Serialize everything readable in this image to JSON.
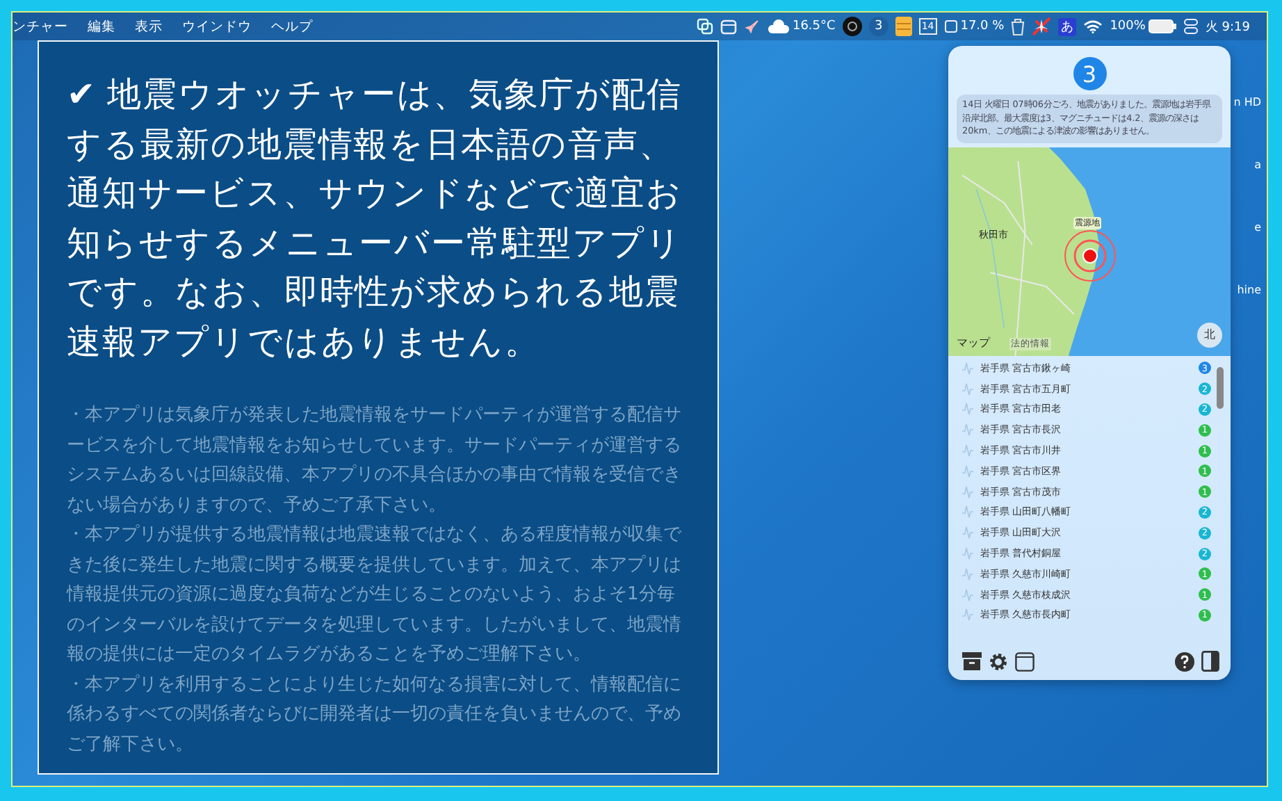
{
  "menu_bar": {
    "items": [
      "ンチャー",
      "編集",
      "表示",
      "ウインドウ",
      "ヘルプ"
    ],
    "status": {
      "temperature": "16.5°C",
      "badge": "3",
      "calendar_day": "14",
      "cpu": "17.0 %",
      "input_method": "あ",
      "battery": "100%",
      "clock": "火 9:19"
    }
  },
  "desktop_icons": [
    "n HD",
    "a",
    "e",
    "hine"
  ],
  "info_panel": {
    "headline": "✔ 地震ウオッチャーは、気象庁が配信する最新の地震情報を日本語の音声、通知サービス、サウンドなどで適宜お知らせするメニューバー常駐型アプリです。なお、即時性が求められる地震速報アプリではありません。",
    "notes": [
      "・本アプリは気象庁が発表した地震情報をサードパーティが運営する配信サービスを介して地震情報をお知らせしています。サードパーティが運営するシステムあるいは回線設備、本アプリの不具合ほかの事由で情報を受信できない場合がありますので、予めご了承下さい。",
      "・本アプリが提供する地震情報は地震速報ではなく、ある程度情報が収集できた後に発生した地震に関する概要を提供しています。加えて、本アプリは情報提供元の資源に過度な負荷などが生じることのないよう、およそ1分毎のインターバルを設けてデータを処理しています。したがいまして、地震情報の提供には一定のタイムラグがあることを予めご理解下さい。",
      "・本アプリを利用することにより生じた如何なる損害に対して、情報配信に係わるすべての関係者ならびに開発者は一切の責任を負いませんので、予めご了解下さい。"
    ]
  },
  "popover": {
    "max_intensity": "3",
    "message": "14日 火曜日 07時06分ごろ、地震がありました。震源地は岩手県沿岸北部。最大震度は3、マグニチュードは4.2、震源の深さは20km、この地震による津波の影響はありません。",
    "map": {
      "city_label": "秋田市",
      "epicenter_label": "震源地",
      "attribution": "マップ",
      "legal": "法的情報",
      "compass": "北"
    },
    "stations": [
      {
        "name": "岩手県 宮古市鍬ヶ崎",
        "intensity": "3",
        "color": "#1f86e8"
      },
      {
        "name": "岩手県 宮古市五月町",
        "intensity": "2",
        "color": "#18b6d2"
      },
      {
        "name": "岩手県 宮古市田老",
        "intensity": "2",
        "color": "#18b6d2"
      },
      {
        "name": "岩手県 宮古市長沢",
        "intensity": "1",
        "color": "#2fbe4e"
      },
      {
        "name": "岩手県 宮古市川井",
        "intensity": "1",
        "color": "#2fbe4e"
      },
      {
        "name": "岩手県 宮古市区界",
        "intensity": "1",
        "color": "#2fbe4e"
      },
      {
        "name": "岩手県 宮古市茂市",
        "intensity": "1",
        "color": "#2fbe4e"
      },
      {
        "name": "岩手県 山田町八幡町",
        "intensity": "2",
        "color": "#18b6d2"
      },
      {
        "name": "岩手県 山田町大沢",
        "intensity": "2",
        "color": "#18b6d2"
      },
      {
        "name": "岩手県 普代村銅屋",
        "intensity": "2",
        "color": "#18b6d2"
      },
      {
        "name": "岩手県 久慈市川崎町",
        "intensity": "1",
        "color": "#2fbe4e"
      },
      {
        "name": "岩手県 久慈市枝成沢",
        "intensity": "1",
        "color": "#2fbe4e"
      },
      {
        "name": "岩手県 久慈市長内町",
        "intensity": "1",
        "color": "#2fbe4e"
      }
    ]
  }
}
